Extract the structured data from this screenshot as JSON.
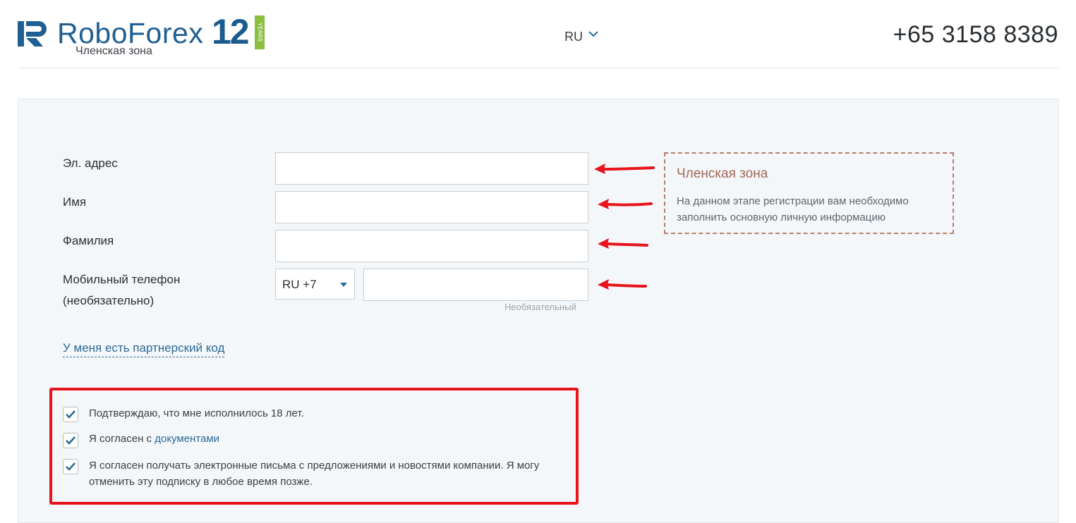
{
  "header": {
    "brand": "RoboForex",
    "brand_years_number": "12",
    "brand_years_word": "YEARS",
    "subtitle": "Членская зона",
    "language": "RU",
    "phone": "+65 3158 8389"
  },
  "form": {
    "email_label": "Эл. адрес",
    "email_value": "",
    "first_name_label": "Имя",
    "first_name_value": "",
    "last_name_label": "Фамилия",
    "last_name_value": "",
    "mobile_label_line1": "Мобильный телефон",
    "mobile_label_line2": "(необязательно)",
    "phone_code": "RU +7",
    "phone_value": "",
    "phone_hint": "Необязательный",
    "partner_link": "У меня есть партнерский код"
  },
  "info": {
    "title": "Членская зона",
    "text": "На данном этапе регистрации вам необходимо заполнить основную личную информацию"
  },
  "consents": [
    {
      "text": "Подтверждаю, что мне исполнилось 18 лет.",
      "checked": true
    },
    {
      "text_prefix": "Я согласен с ",
      "link": "документами",
      "checked": true
    },
    {
      "text": "Я согласен получать электронные письма с предложениями и новостями компании. Я могу отменить эту подписку в любое время позже.",
      "checked": true
    }
  ],
  "colors": {
    "brand_blue": "#1f5f93",
    "link_blue": "#2b6a97",
    "annotation_red": "#e8141c",
    "years_green": "#8cbf3f"
  }
}
